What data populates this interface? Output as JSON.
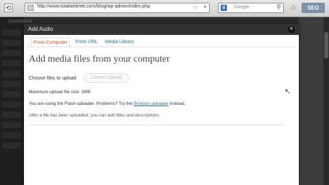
{
  "browser": {
    "url": "http://www.totalwebnet.com/blog/wp-admin/index.php",
    "search_engine": "Google",
    "search_placeholder": "Google",
    "addon_label": "SEO"
  },
  "admin": {
    "header_text": "Dashboard"
  },
  "modal": {
    "title": "Add Audio",
    "tabs": [
      {
        "label": "From Computer",
        "active": true
      },
      {
        "label": "From URL",
        "active": false
      },
      {
        "label": "Media Library",
        "active": false
      }
    ],
    "heading": "Add media files from your computer",
    "choose_label": "Choose files to upload",
    "cancel_label": "Cancel Upload",
    "max_size": "Maximum upload file size: 2MB",
    "flash_prefix": "You are using the Flash uploader. Problems? Try the ",
    "flash_link": "Browser uploader",
    "flash_suffix": " instead.",
    "after_upload": "After a file has been uploaded, you can add titles and descriptions."
  },
  "colors": {
    "link": "#21759b",
    "active_tab": "#d54e21",
    "title_bar": "#333333"
  }
}
